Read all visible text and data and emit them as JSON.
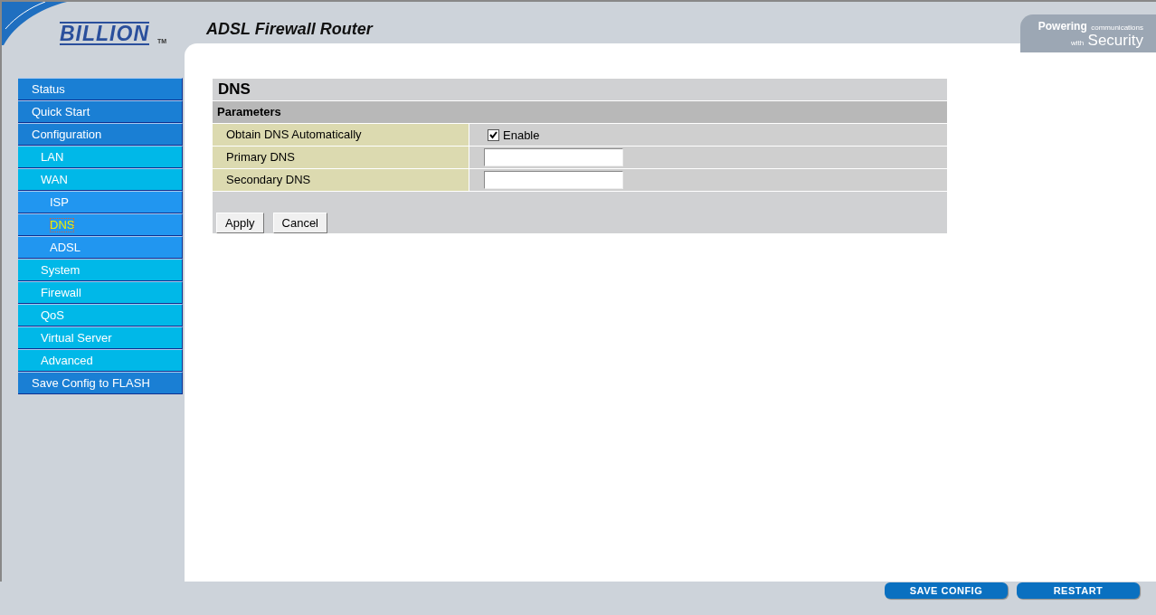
{
  "header": {
    "logo": "BILLION",
    "trademark": "TM",
    "title": "ADSL Firewall Router",
    "tagline_strong": "Powering",
    "tagline_small": "communications",
    "tagline_with": "with",
    "tagline_big": "Security"
  },
  "menu": [
    {
      "label": "Status",
      "selected": false
    },
    {
      "label": "Quick Start",
      "selected": false
    },
    {
      "label": "Configuration",
      "selected": false,
      "children": [
        {
          "label": "LAN",
          "selected": false
        },
        {
          "label": "WAN",
          "selected": false,
          "children": [
            {
              "label": "ISP",
              "selected": false
            },
            {
              "label": "DNS",
              "selected": true
            },
            {
              "label": "ADSL",
              "selected": false
            }
          ]
        },
        {
          "label": "System",
          "selected": false
        },
        {
          "label": "Firewall",
          "selected": false
        },
        {
          "label": "QoS",
          "selected": false
        },
        {
          "label": "Virtual Server",
          "selected": false
        },
        {
          "label": "Advanced",
          "selected": false
        }
      ]
    },
    {
      "label": "Save Config to FLASH",
      "selected": false
    }
  ],
  "form": {
    "title": "DNS",
    "section": "Parameters",
    "rows": [
      {
        "kind": "checkbox",
        "label": "Obtain DNS Automatically",
        "option": "Enable",
        "checked": true
      },
      {
        "kind": "text",
        "label": "Primary DNS"
      },
      {
        "kind": "text",
        "label": "Secondary DNS"
      }
    ],
    "buttons": [
      "Apply",
      "Cancel"
    ]
  },
  "footer": {
    "buttons": [
      "SAVE CONFIG",
      "RESTART"
    ]
  }
}
